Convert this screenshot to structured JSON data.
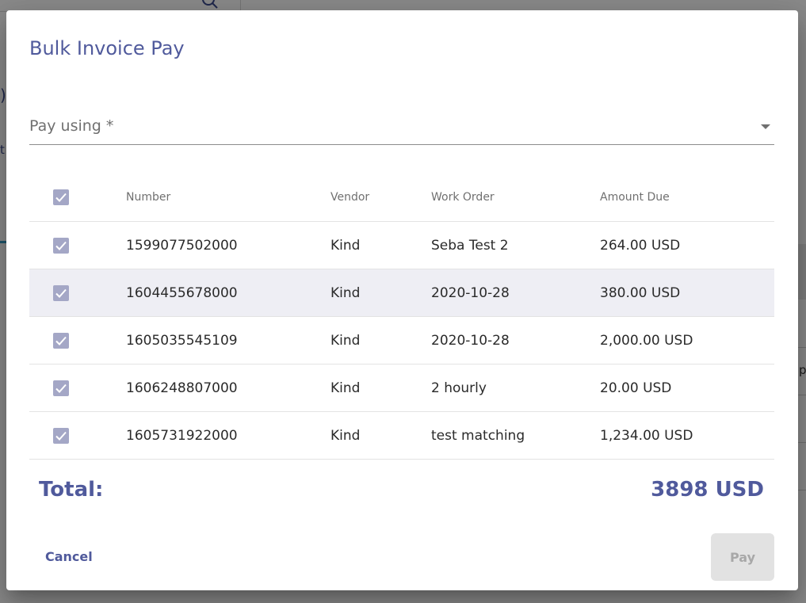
{
  "dialog": {
    "title": "Bulk Invoice Pay",
    "pay_using_label": "Pay using *",
    "columns": {
      "number": "Number",
      "vendor": "Vendor",
      "work_order": "Work Order",
      "amount_due": "Amount Due"
    },
    "rows": [
      {
        "number": "1599077502000",
        "vendor": "Kind",
        "work_order": "Seba Test 2",
        "amount_due": "264.00 USD",
        "checked": true
      },
      {
        "number": "1604455678000",
        "vendor": "Kind",
        "work_order": "2020-10-28",
        "amount_due": "380.00 USD",
        "checked": true
      },
      {
        "number": "1605035545109",
        "vendor": "Kind",
        "work_order": "2020-10-28",
        "amount_due": "2,000.00 USD",
        "checked": true
      },
      {
        "number": "1606248807000",
        "vendor": "Kind",
        "work_order": "2 hourly",
        "amount_due": "20.00 USD",
        "checked": true
      },
      {
        "number": "1605731922000",
        "vendor": "Kind",
        "work_order": "test matching",
        "amount_due": "1,234.00 USD",
        "checked": true
      }
    ],
    "total_label": "Total:",
    "total_value": "3898 USD",
    "cancel_label": "Cancel",
    "pay_label": "Pay"
  },
  "colors": {
    "accent": "#505a9c",
    "checkbox": "#a4a7c6",
    "row_highlight": "#eeeef4",
    "disabled_button": "#e2e2e2"
  }
}
